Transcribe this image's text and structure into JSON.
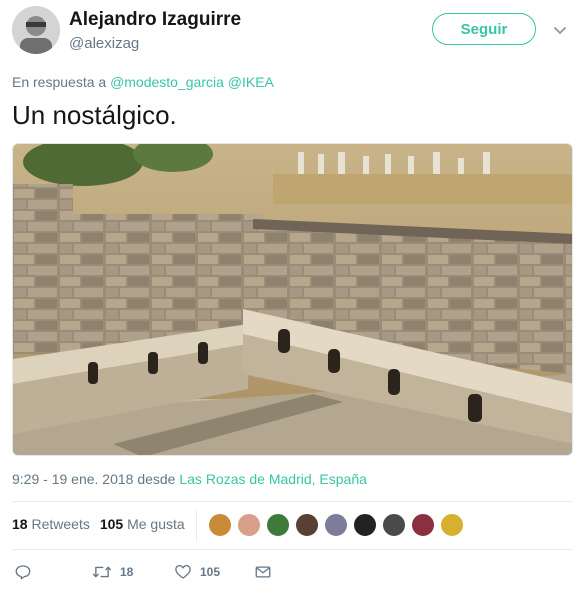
{
  "author": {
    "display_name": "Alejandro Izaguirre",
    "handle": "@alexizag",
    "avatar_icon": "avatar-photo"
  },
  "follow_button": {
    "label": "Seguir",
    "color": "#39c5a6"
  },
  "menu": {
    "icon": "chevron-down-icon"
  },
  "reply_context": {
    "prefix": "En respuesta a",
    "mentions": [
      "@modesto_garcia",
      "@IKEA"
    ]
  },
  "tweet": {
    "text": "Un nostálgico."
  },
  "media": {
    "description": "photo-ancient-roman-latrines"
  },
  "meta": {
    "time_date": "9:29 - 19 ene. 2018 desde",
    "place": "Las Rozas de Madrid, España"
  },
  "stats": {
    "retweets_count": "18",
    "retweets_label": "Retweets",
    "likes_count": "105",
    "likes_label": "Me gusta"
  },
  "liked_by_avatars": [
    {
      "name": "liker-1",
      "color": "#c98a3a"
    },
    {
      "name": "liker-2",
      "color": "#d8a08a"
    },
    {
      "name": "liker-3",
      "color": "#3e7a3a"
    },
    {
      "name": "liker-4",
      "color": "#5a4032"
    },
    {
      "name": "liker-5",
      "color": "#7d7d9a"
    },
    {
      "name": "liker-6",
      "color": "#222222"
    },
    {
      "name": "liker-7",
      "color": "#4a4a4a"
    },
    {
      "name": "liker-8",
      "color": "#8a3040"
    },
    {
      "name": "liker-9",
      "color": "#d8b030"
    }
  ],
  "actions": {
    "reply": {
      "icon": "reply-icon"
    },
    "retweet": {
      "icon": "retweet-icon",
      "count": "18"
    },
    "like": {
      "icon": "heart-icon",
      "count": "105"
    },
    "dm": {
      "icon": "envelope-icon"
    }
  },
  "colors": {
    "accent": "#39c5a6",
    "secondary_text": "#657786"
  }
}
